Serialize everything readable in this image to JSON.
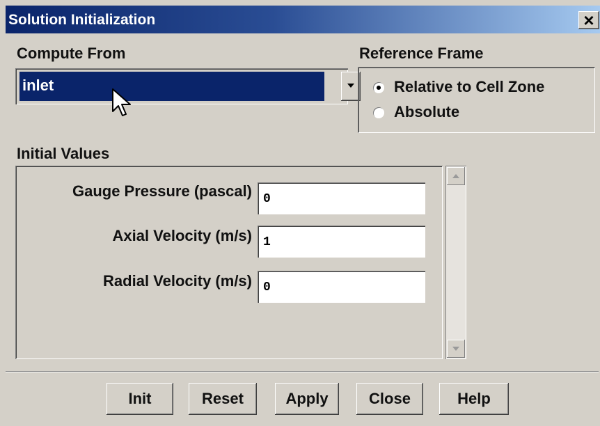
{
  "window": {
    "title": "Solution Initialization",
    "close_glyph": "×"
  },
  "compute_from": {
    "label": "Compute From",
    "selected": "inlet"
  },
  "reference_frame": {
    "label": "Reference Frame",
    "options": [
      {
        "label": "Relative to Cell Zone",
        "selected": true
      },
      {
        "label": "Absolute",
        "selected": false
      }
    ]
  },
  "initial_values": {
    "label": "Initial Values",
    "fields": [
      {
        "label": "Gauge Pressure (pascal)",
        "value": "0"
      },
      {
        "label": "Axial Velocity (m/s)",
        "value": "1"
      },
      {
        "label": "Radial Velocity (m/s)",
        "value": "0"
      }
    ]
  },
  "buttons": {
    "init": "Init",
    "reset": "Reset",
    "apply": "Apply",
    "close": "Close",
    "help": "Help"
  },
  "icons": {
    "dropdown": "chevron-down-icon",
    "scroll_up": "arrow-up-icon",
    "scroll_down": "arrow-down-icon",
    "cursor": "mouse-pointer-icon"
  },
  "colors": {
    "title_bar": "#0a246a",
    "selection": "#0a246a",
    "face": "#d4d0c8"
  }
}
